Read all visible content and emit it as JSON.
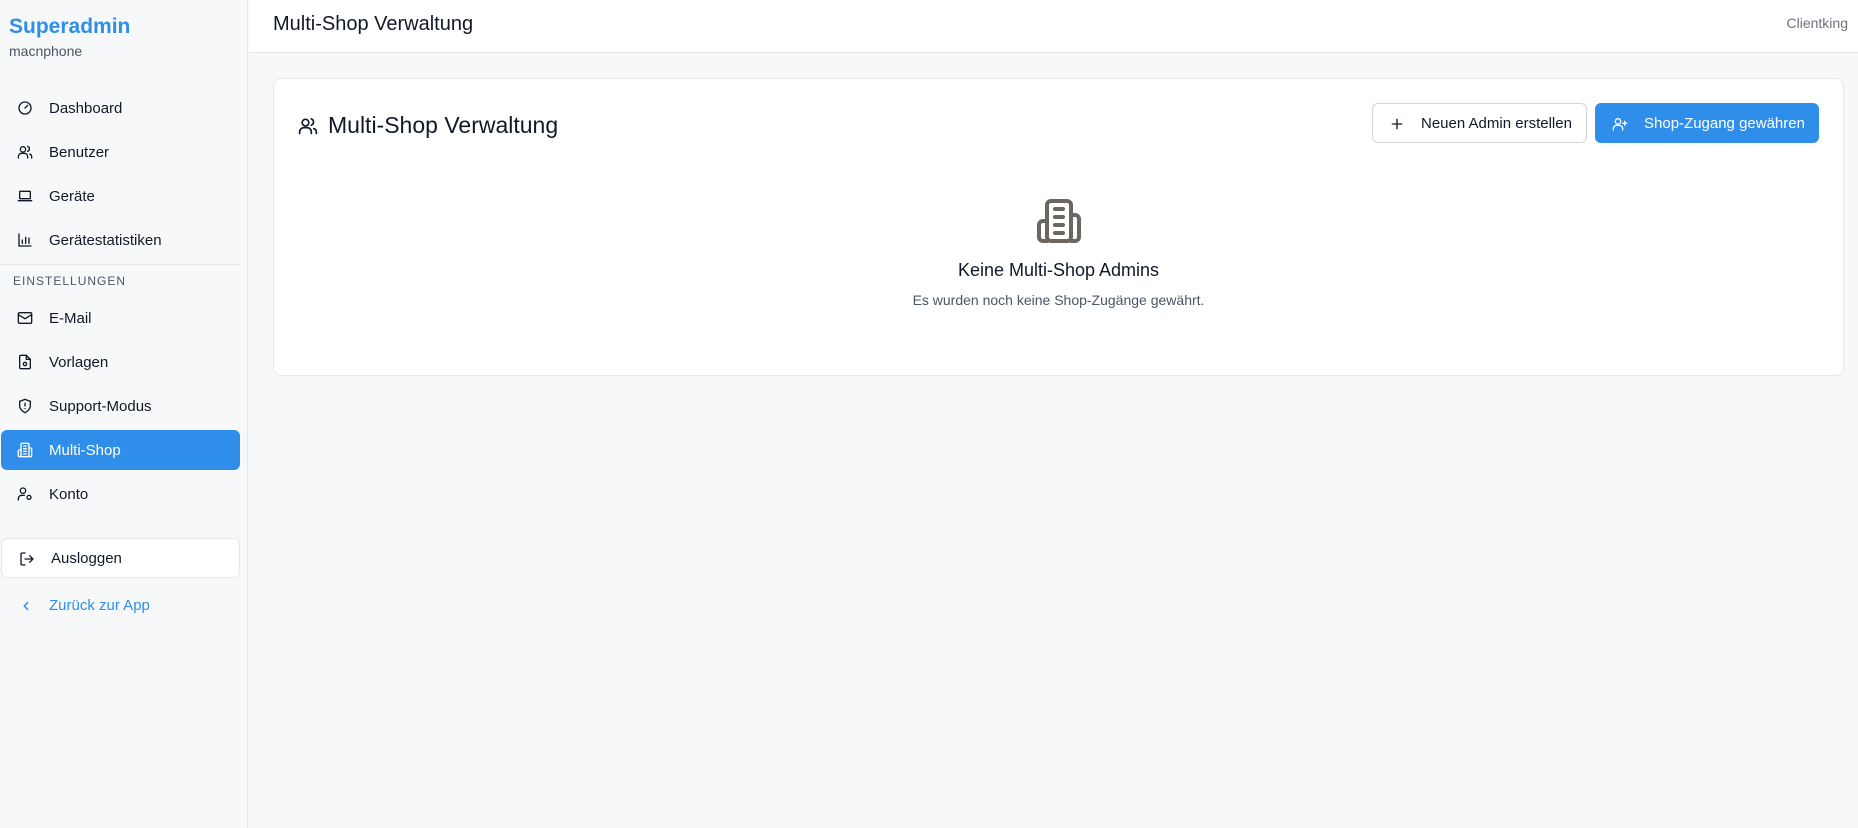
{
  "sidebar": {
    "brand_title": "Superadmin",
    "brand_subtitle": "macnphone",
    "items": [
      {
        "label": "Dashboard",
        "icon": "gauge-icon"
      },
      {
        "label": "Benutzer",
        "icon": "users-icon"
      },
      {
        "label": "Geräte",
        "icon": "laptop-icon"
      },
      {
        "label": "Gerätestatistiken",
        "icon": "bar-chart-icon"
      }
    ],
    "section_label": "EINSTELLUNGEN",
    "settings_items": [
      {
        "label": "E-Mail",
        "icon": "mail-icon"
      },
      {
        "label": "Vorlagen",
        "icon": "file-icon"
      },
      {
        "label": "Support-Modus",
        "icon": "shield-icon"
      },
      {
        "label": "Multi-Shop",
        "icon": "building-icon",
        "active": true
      },
      {
        "label": "Konto",
        "icon": "user-cog-icon"
      }
    ],
    "logout_label": "Ausloggen",
    "back_label": "Zurück zur App"
  },
  "header": {
    "title": "Multi-Shop Verwaltung",
    "right_text": "Clientking"
  },
  "card": {
    "title": "Multi-Shop Verwaltung",
    "new_admin_label": "Neuen Admin erstellen",
    "grant_access_label": "Shop-Zugang gewähren",
    "empty_title": "Keine Multi-Shop Admins",
    "empty_subtitle": "Es wurden noch keine Shop-Zugänge gewährt."
  },
  "colors": {
    "accent": "#2f8ee9",
    "background": "#f7f8f9",
    "text": "#111827",
    "muted": "#4b5563"
  }
}
